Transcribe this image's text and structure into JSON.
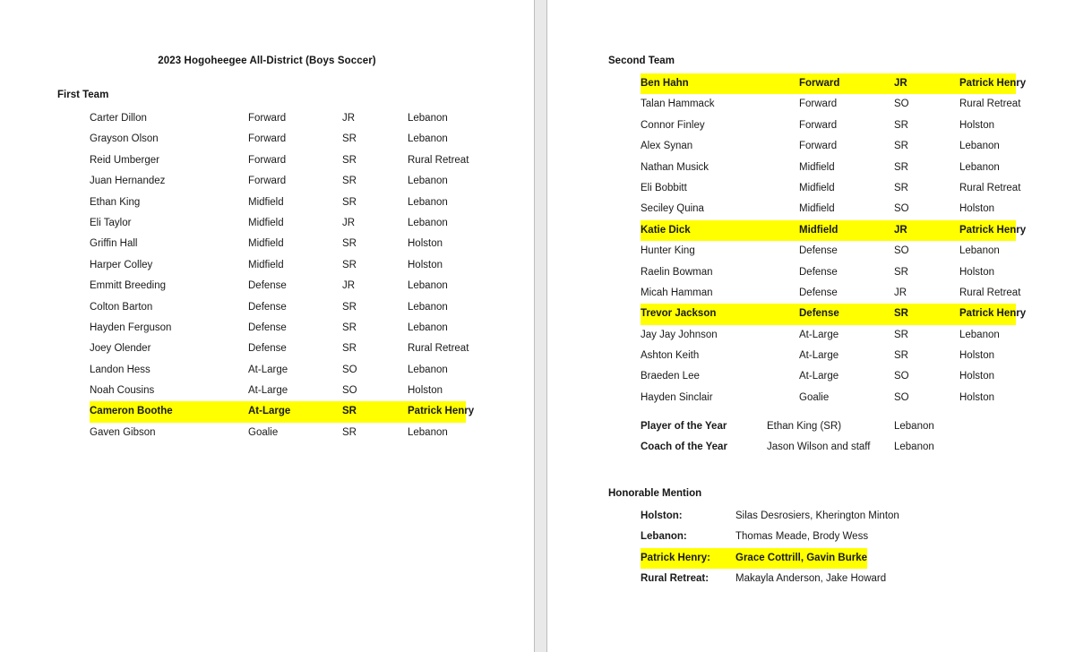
{
  "document": {
    "title": "2023 Hogoheegee All-District (Boys Soccer)"
  },
  "left_page": {
    "first_team": {
      "heading": "First Team",
      "rows": [
        {
          "name": "Carter Dillon",
          "position": "Forward",
          "year": "JR",
          "school": "Lebanon",
          "highlight": false
        },
        {
          "name": "Grayson Olson",
          "position": "Forward",
          "year": "SR",
          "school": "Lebanon",
          "highlight": false
        },
        {
          "name": "Reid Umberger",
          "position": "Forward",
          "year": "SR",
          "school": "Rural Retreat",
          "highlight": false
        },
        {
          "name": "Juan Hernandez",
          "position": "Forward",
          "year": "SR",
          "school": "Lebanon",
          "highlight": false
        },
        {
          "name": "Ethan King",
          "position": "Midfield",
          "year": "SR",
          "school": "Lebanon",
          "highlight": false
        },
        {
          "name": "Eli Taylor",
          "position": "Midfield",
          "year": "JR",
          "school": "Lebanon",
          "highlight": false
        },
        {
          "name": "Griffin Hall",
          "position": "Midfield",
          "year": "SR",
          "school": "Holston",
          "highlight": false
        },
        {
          "name": "Harper Colley",
          "position": "Midfield",
          "year": "SR",
          "school": "Holston",
          "highlight": false
        },
        {
          "name": "Emmitt Breeding",
          "position": "Defense",
          "year": "JR",
          "school": "Lebanon",
          "highlight": false
        },
        {
          "name": "Colton Barton",
          "position": "Defense",
          "year": "SR",
          "school": "Lebanon",
          "highlight": false
        },
        {
          "name": "Hayden Ferguson",
          "position": "Defense",
          "year": "SR",
          "school": "Lebanon",
          "highlight": false
        },
        {
          "name": "Joey Olender",
          "position": "Defense",
          "year": "SR",
          "school": "Rural Retreat",
          "highlight": false
        },
        {
          "name": "Landon Hess",
          "position": "At-Large",
          "year": "SO",
          "school": "Lebanon",
          "highlight": false
        },
        {
          "name": "Noah Cousins",
          "position": "At-Large",
          "year": "SO",
          "school": "Holston",
          "highlight": false
        },
        {
          "name": "Cameron Boothe",
          "position": "At-Large",
          "year": "SR",
          "school": "Patrick Henry",
          "highlight": true
        },
        {
          "name": "Gaven Gibson",
          "position": "Goalie",
          "year": "SR",
          "school": "Lebanon",
          "highlight": false
        }
      ]
    }
  },
  "right_page": {
    "second_team": {
      "heading": "Second Team",
      "rows": [
        {
          "name": "Ben Hahn",
          "position": "Forward",
          "year": "JR",
          "school": "Patrick Henry",
          "highlight": true
        },
        {
          "name": "Talan Hammack",
          "position": "Forward",
          "year": "SO",
          "school": "Rural Retreat",
          "highlight": false
        },
        {
          "name": "Connor Finley",
          "position": "Forward",
          "year": "SR",
          "school": "Holston",
          "highlight": false
        },
        {
          "name": "Alex Synan",
          "position": "Forward",
          "year": "SR",
          "school": "Lebanon",
          "highlight": false
        },
        {
          "name": "Nathan Musick",
          "position": "Midfield",
          "year": "SR",
          "school": "Lebanon",
          "highlight": false
        },
        {
          "name": "Eli Bobbitt",
          "position": "Midfield",
          "year": "SR",
          "school": "Rural Retreat",
          "highlight": false
        },
        {
          "name": "Seciley Quina",
          "position": "Midfield",
          "year": "SO",
          "school": "Holston",
          "highlight": false
        },
        {
          "name": "Katie Dick",
          "position": "Midfield",
          "year": "JR",
          "school": "Patrick Henry",
          "highlight": true
        },
        {
          "name": "Hunter King",
          "position": "Defense",
          "year": "SO",
          "school": "Lebanon",
          "highlight": false
        },
        {
          "name": "Raelin Bowman",
          "position": "Defense",
          "year": "SR",
          "school": "Holston",
          "highlight": false
        },
        {
          "name": "Micah Hamman",
          "position": "Defense",
          "year": "JR",
          "school": "Rural Retreat",
          "highlight": false
        },
        {
          "name": "Trevor Jackson",
          "position": "Defense",
          "year": "SR",
          "school": "Patrick Henry",
          "highlight": true
        },
        {
          "name": "Jay Jay Johnson",
          "position": "At-Large",
          "year": "SR",
          "school": "Lebanon",
          "highlight": false
        },
        {
          "name": "Ashton Keith",
          "position": "At-Large",
          "year": "SR",
          "school": "Holston",
          "highlight": false
        },
        {
          "name": "Braeden Lee",
          "position": "At-Large",
          "year": "SO",
          "school": "Holston",
          "highlight": false
        },
        {
          "name": "Hayden Sinclair",
          "position": "Goalie",
          "year": "SO",
          "school": "Holston",
          "highlight": false
        }
      ]
    },
    "awards": [
      {
        "label": "Player of the Year",
        "value": "Ethan King (SR)",
        "school": "Lebanon"
      },
      {
        "label": "Coach of the Year",
        "value": "Jason Wilson and staff",
        "school": "Lebanon"
      }
    ],
    "honorable_mention": {
      "heading": "Honorable Mention",
      "rows": [
        {
          "label": "Holston:",
          "value": "Silas Desrosiers, Kherington Minton",
          "highlight": false
        },
        {
          "label": "Lebanon:",
          "value": "Thomas Meade, Brody Wess",
          "highlight": false
        },
        {
          "label": "Patrick Henry:",
          "value": "Grace Cottrill, Gavin Burke",
          "highlight": true
        },
        {
          "label": "Rural Retreat:",
          "value": "Makayla Anderson, Jake Howard",
          "highlight": false
        }
      ]
    }
  },
  "colors": {
    "highlight": "#ffff00",
    "text": "#1a1a1a",
    "gutter": "#e9e9e9"
  }
}
